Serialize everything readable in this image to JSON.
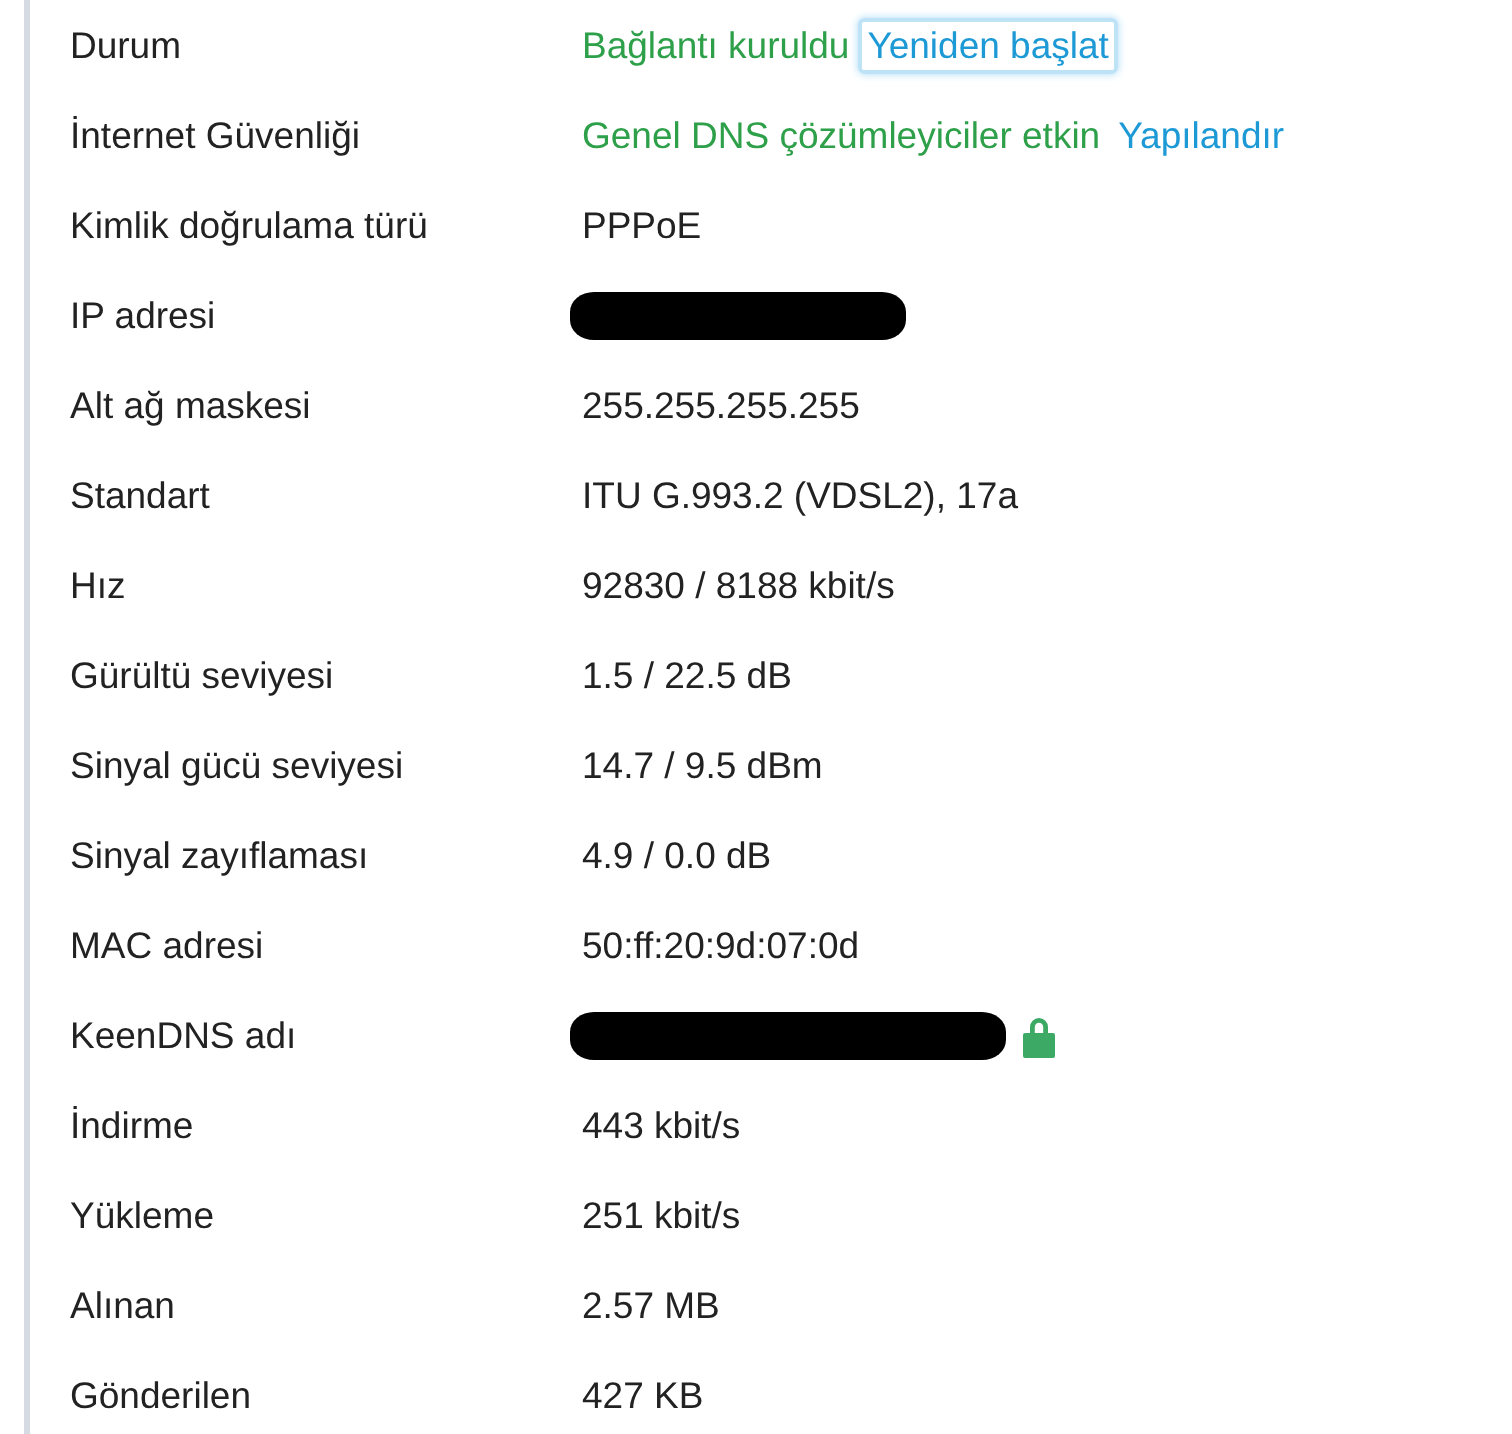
{
  "rows": [
    {
      "label": "Durum",
      "parts": [
        {
          "kind": "status",
          "text": "Bağlantı kuruldu"
        },
        {
          "kind": "link",
          "text": "Yeniden başlat",
          "focused": true
        }
      ]
    },
    {
      "label": "İnternet Güvenliği",
      "parts": [
        {
          "kind": "status",
          "text": "Genel DNS çözümleyiciler etkin"
        },
        {
          "kind": "link",
          "text": "Yapılandır",
          "focused": false
        }
      ]
    },
    {
      "label": "Kimlik doğrulama türü",
      "parts": [
        {
          "kind": "text",
          "text": "PPPoE"
        }
      ]
    },
    {
      "label": "IP adresi",
      "parts": [
        {
          "kind": "redacted"
        }
      ]
    },
    {
      "label": "Alt ağ maskesi",
      "parts": [
        {
          "kind": "text",
          "text": "255.255.255.255"
        }
      ]
    },
    {
      "label": "Standart",
      "parts": [
        {
          "kind": "text",
          "text": "ITU G.993.2 (VDSL2), 17a"
        }
      ]
    },
    {
      "label": "Hız",
      "parts": [
        {
          "kind": "text",
          "text": "92830 / 8188 kbit/s"
        }
      ]
    },
    {
      "label": "Gürültü seviyesi",
      "parts": [
        {
          "kind": "text",
          "text": "1.5 / 22.5 dB"
        }
      ]
    },
    {
      "label": "Sinyal gücü seviyesi",
      "parts": [
        {
          "kind": "text",
          "text": "14.7 / 9.5 dBm"
        }
      ]
    },
    {
      "label": "Sinyal zayıflaması",
      "parts": [
        {
          "kind": "text",
          "text": "4.9 / 0.0 dB"
        }
      ]
    },
    {
      "label": "MAC adresi",
      "parts": [
        {
          "kind": "text",
          "text": "50:ff:20:9d:07:0d"
        }
      ]
    },
    {
      "label": "KeenDNS adı",
      "parts": [
        {
          "kind": "redacted"
        },
        {
          "kind": "lock"
        }
      ]
    },
    {
      "label": "İndirme",
      "parts": [
        {
          "kind": "text",
          "text": "443 kbit/s"
        }
      ]
    },
    {
      "label": "Yükleme",
      "parts": [
        {
          "kind": "text",
          "text": "251 kbit/s"
        }
      ]
    },
    {
      "label": "Alınan",
      "parts": [
        {
          "kind": "text",
          "text": "2.57 MB"
        }
      ]
    },
    {
      "label": "Gönderilen",
      "parts": [
        {
          "kind": "text",
          "text": "427 KB"
        }
      ]
    }
  ]
}
